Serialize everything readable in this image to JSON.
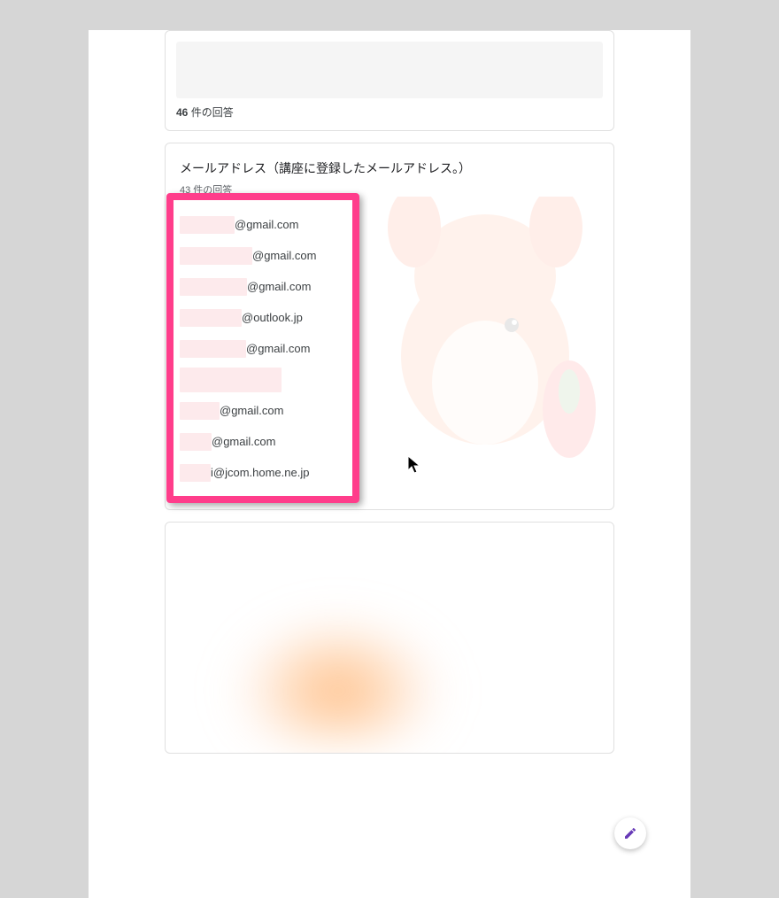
{
  "card1": {
    "count_bold": "46",
    "count_rest": " 件の回答"
  },
  "card2": {
    "title": "メールアドレス（講座に登録したメールアドレス。）",
    "sub_count": "43 件の回答",
    "emails": [
      {
        "visible": "@gmail.com"
      },
      {
        "visible": "@gmail.com"
      },
      {
        "visible": "@gmail.com"
      },
      {
        "visible": "@outlook.jp"
      },
      {
        "visible": "@gmail.com"
      },
      {
        "visible": ""
      },
      {
        "visible": "@gmail.com"
      },
      {
        "visible": "@gmail.com"
      },
      {
        "visible": "i@jcom.home.ne.jp"
      }
    ]
  }
}
